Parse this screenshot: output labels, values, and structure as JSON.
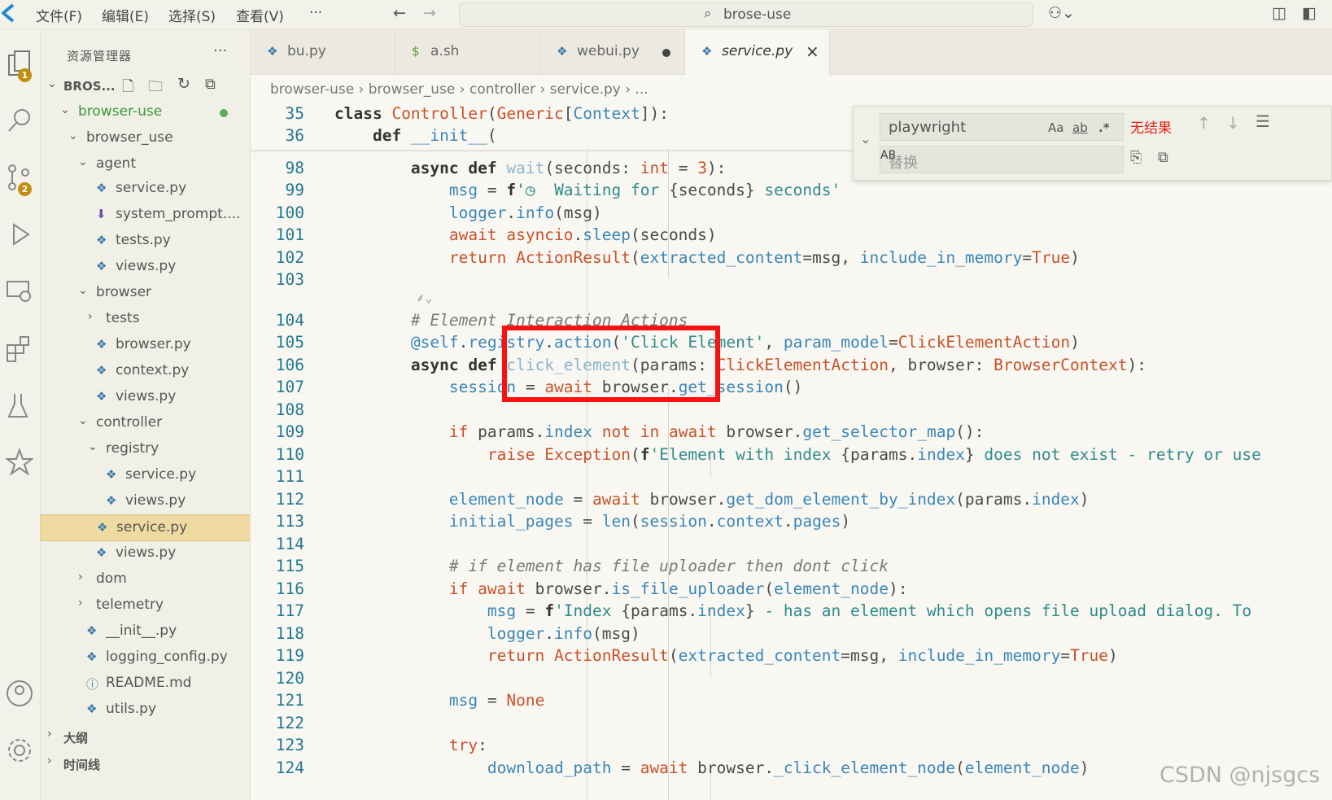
{
  "menu": [
    "文件(F)",
    "编辑(E)",
    "选择(S)",
    "查看(V)",
    "···"
  ],
  "search": {
    "text": "brose-use"
  },
  "sidebar": {
    "title": "资源管理器",
    "more": "···",
    "root": "BROS...",
    "tree": [
      {
        "label": "browser-use",
        "depth": 1,
        "type": "folder-open",
        "modified": true
      },
      {
        "label": "browser_use",
        "depth": 2,
        "type": "folder-open"
      },
      {
        "label": "agent",
        "depth": 3,
        "type": "folder-open"
      },
      {
        "label": "service.py",
        "depth": 4,
        "type": "py"
      },
      {
        "label": "system_prompt....",
        "depth": 4,
        "type": "download"
      },
      {
        "label": "tests.py",
        "depth": 4,
        "type": "py"
      },
      {
        "label": "views.py",
        "depth": 4,
        "type": "py"
      },
      {
        "label": "browser",
        "depth": 3,
        "type": "folder-open"
      },
      {
        "label": "tests",
        "depth": 4,
        "type": "folder"
      },
      {
        "label": "browser.py",
        "depth": 4,
        "type": "py"
      },
      {
        "label": "context.py",
        "depth": 4,
        "type": "py"
      },
      {
        "label": "views.py",
        "depth": 4,
        "type": "py"
      },
      {
        "label": "controller",
        "depth": 3,
        "type": "folder-open"
      },
      {
        "label": "registry",
        "depth": 4,
        "type": "folder-open"
      },
      {
        "label": "service.py",
        "depth": 5,
        "type": "py"
      },
      {
        "label": "views.py",
        "depth": 5,
        "type": "py"
      },
      {
        "label": "service.py",
        "depth": 4,
        "type": "py",
        "selected": true
      },
      {
        "label": "views.py",
        "depth": 4,
        "type": "py"
      },
      {
        "label": "dom",
        "depth": 3,
        "type": "folder"
      },
      {
        "label": "telemetry",
        "depth": 3,
        "type": "folder"
      },
      {
        "label": "__init__.py",
        "depth": 3,
        "type": "py"
      },
      {
        "label": "logging_config.py",
        "depth": 3,
        "type": "py"
      },
      {
        "label": "README.md",
        "depth": 3,
        "type": "info"
      },
      {
        "label": "utils.py",
        "depth": 3,
        "type": "py"
      }
    ],
    "outline": "大纲",
    "timeline": "时间线"
  },
  "tabs": [
    {
      "label": "bu.py",
      "icon": "py"
    },
    {
      "label": "a.sh",
      "icon": "sh"
    },
    {
      "label": "webui.py",
      "icon": "py",
      "dirty": true
    },
    {
      "label": "service.py",
      "icon": "py",
      "active": true
    }
  ],
  "breadcrumb": "browser-use › browser_use › controller › service.py › ...",
  "find": {
    "query": "playwright",
    "replace_placeholder": "替换",
    "status": "无结果"
  },
  "activity_badges": {
    "explorer": "1",
    "scm": "2"
  },
  "watermark": "CSDN @njsgcs"
}
